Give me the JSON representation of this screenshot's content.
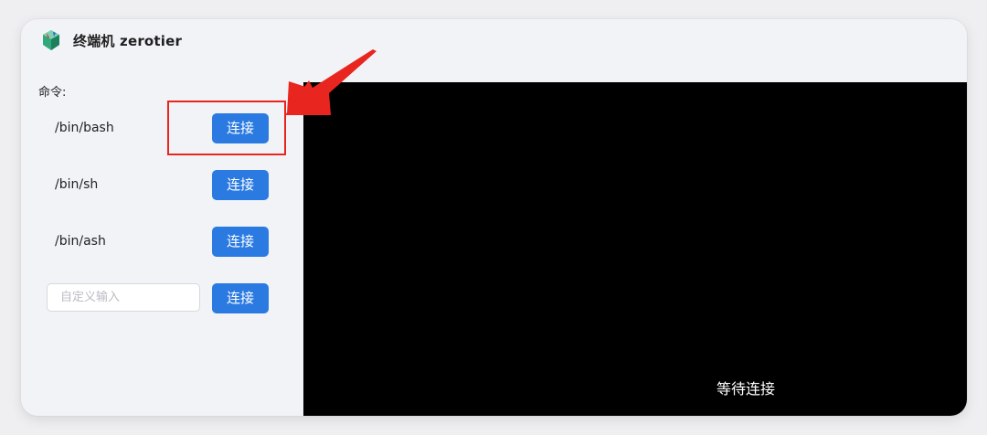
{
  "window": {
    "title": "终端机 zerotier",
    "icon": "zerotier-logo-icon"
  },
  "commands": {
    "label": "命令:",
    "items": [
      {
        "command": "/bin/bash",
        "button_label": "连接"
      },
      {
        "command": "/bin/sh",
        "button_label": "连接"
      },
      {
        "command": "/bin/ash",
        "button_label": "连接"
      }
    ],
    "custom": {
      "placeholder": "自定义输入",
      "value": "",
      "button_label": "连接"
    }
  },
  "terminal": {
    "status_text": "等待连接"
  },
  "annotation": {
    "highlight_color": "#e8261f",
    "arrow_icon": "red-arrow-icon"
  },
  "colors": {
    "button_blue": "#2a7ae2",
    "terminal_bg": "#000000",
    "panel_bg": "#f2f3f7"
  }
}
